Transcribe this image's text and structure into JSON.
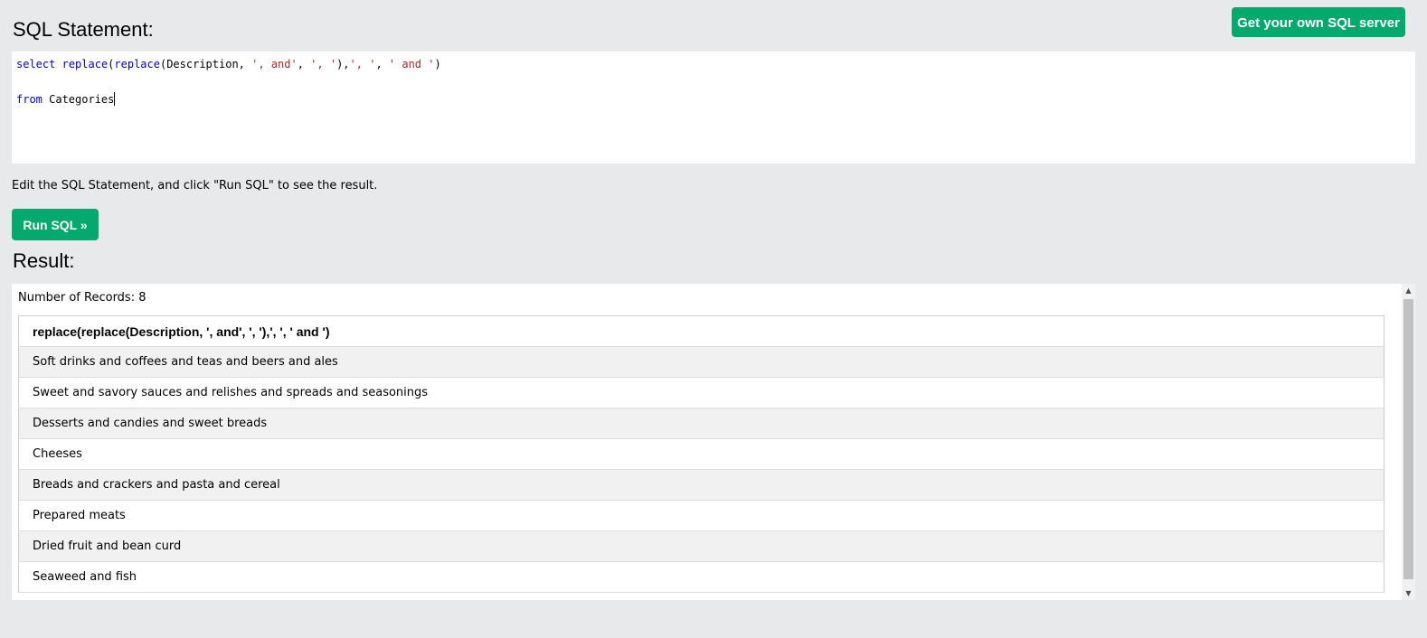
{
  "header": {
    "get_server_label": "Get your own SQL server",
    "sql_heading": "SQL Statement:"
  },
  "editor": {
    "line1": {
      "kw_select": "select",
      "fn1": "replace",
      "paren1": "(",
      "fn2": "replace",
      "args": "(Description, ",
      "str1": "', and'",
      "comma1": ", ",
      "str2": "', '",
      "close1": "),",
      "str3": "', '",
      "comma2": ", ",
      "str4": "' and '",
      "close2": ")"
    },
    "line3": {
      "kw_from": "from",
      "table": " Categories"
    }
  },
  "hint": "Edit the SQL Statement, and click \"Run SQL\" to see the result.",
  "run_button_label": "Run SQL »",
  "result": {
    "heading": "Result:",
    "record_count": "Number of Records: 8",
    "column_header": "replace(replace(Description, ', and', ', '),', ', ' and ')",
    "rows": [
      "Soft drinks and coffees and teas and beers and ales",
      "Sweet and savory sauces and relishes and spreads and seasonings",
      "Desserts and candies and sweet breads",
      "Cheeses",
      "Breads and crackers and pasta and cereal",
      "Prepared meats",
      "Dried fruit and bean curd",
      "Seaweed and fish"
    ]
  },
  "scrollbar": {
    "up_icon": "▲",
    "down_icon": "▼"
  },
  "colors": {
    "accent_green": "#04aa6d",
    "page_background": "#e7e9eb",
    "sql_keyword": "#0000cd",
    "sql_string": "#a52a2a"
  }
}
